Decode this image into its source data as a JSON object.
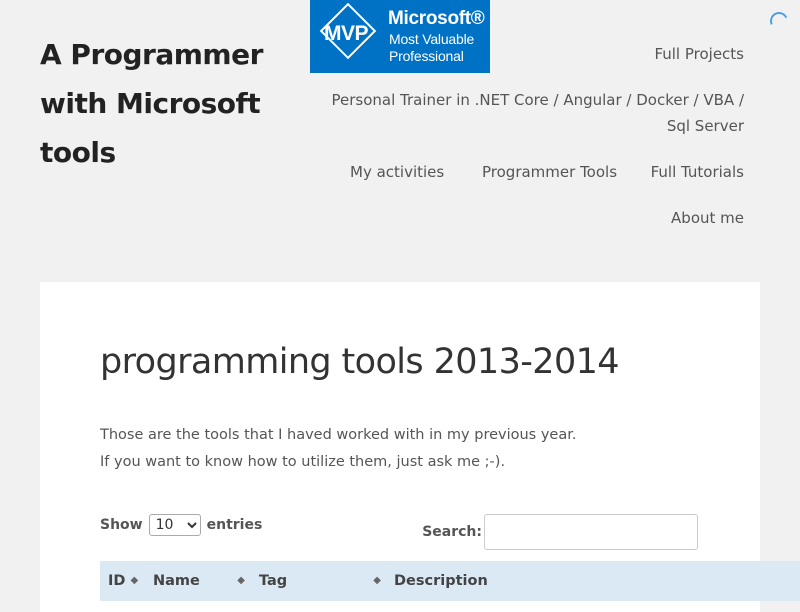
{
  "site": {
    "title": "A Programmer with Microsoft tools"
  },
  "badge": {
    "diamond_text": "MVP",
    "brand": "Microsoft®",
    "line1": "Most Valuable",
    "line2": "Professional",
    "color": "#0072c6"
  },
  "nav": {
    "full_projects": "Full Projects",
    "trainer": "Personal Trainer in .NET Core / Angular / Docker / VBA / Sql Server",
    "my_activities": "My activities",
    "programmer_tools": "Programmer Tools",
    "full_tutorials": "Full Tutorials",
    "about_me": "About me"
  },
  "main": {
    "title": "programming tools 2013-2014",
    "intro_line1": "Those are the tools that I haved worked with in my previous year.",
    "intro_line2": "If you want to know how to utilize them, just ask me ;-)."
  },
  "table_controls": {
    "show_label": "Show",
    "entries_label": "entries",
    "page_length_selected": "10",
    "search_label": "Search:",
    "search_value": ""
  },
  "table": {
    "columns": [
      "ID",
      "Name",
      "Tag",
      "Description"
    ],
    "header_color": "#dbe9f5"
  },
  "icons": {
    "spinner": "loading-spinner-icon",
    "sort": "sort-arrows-icon"
  }
}
